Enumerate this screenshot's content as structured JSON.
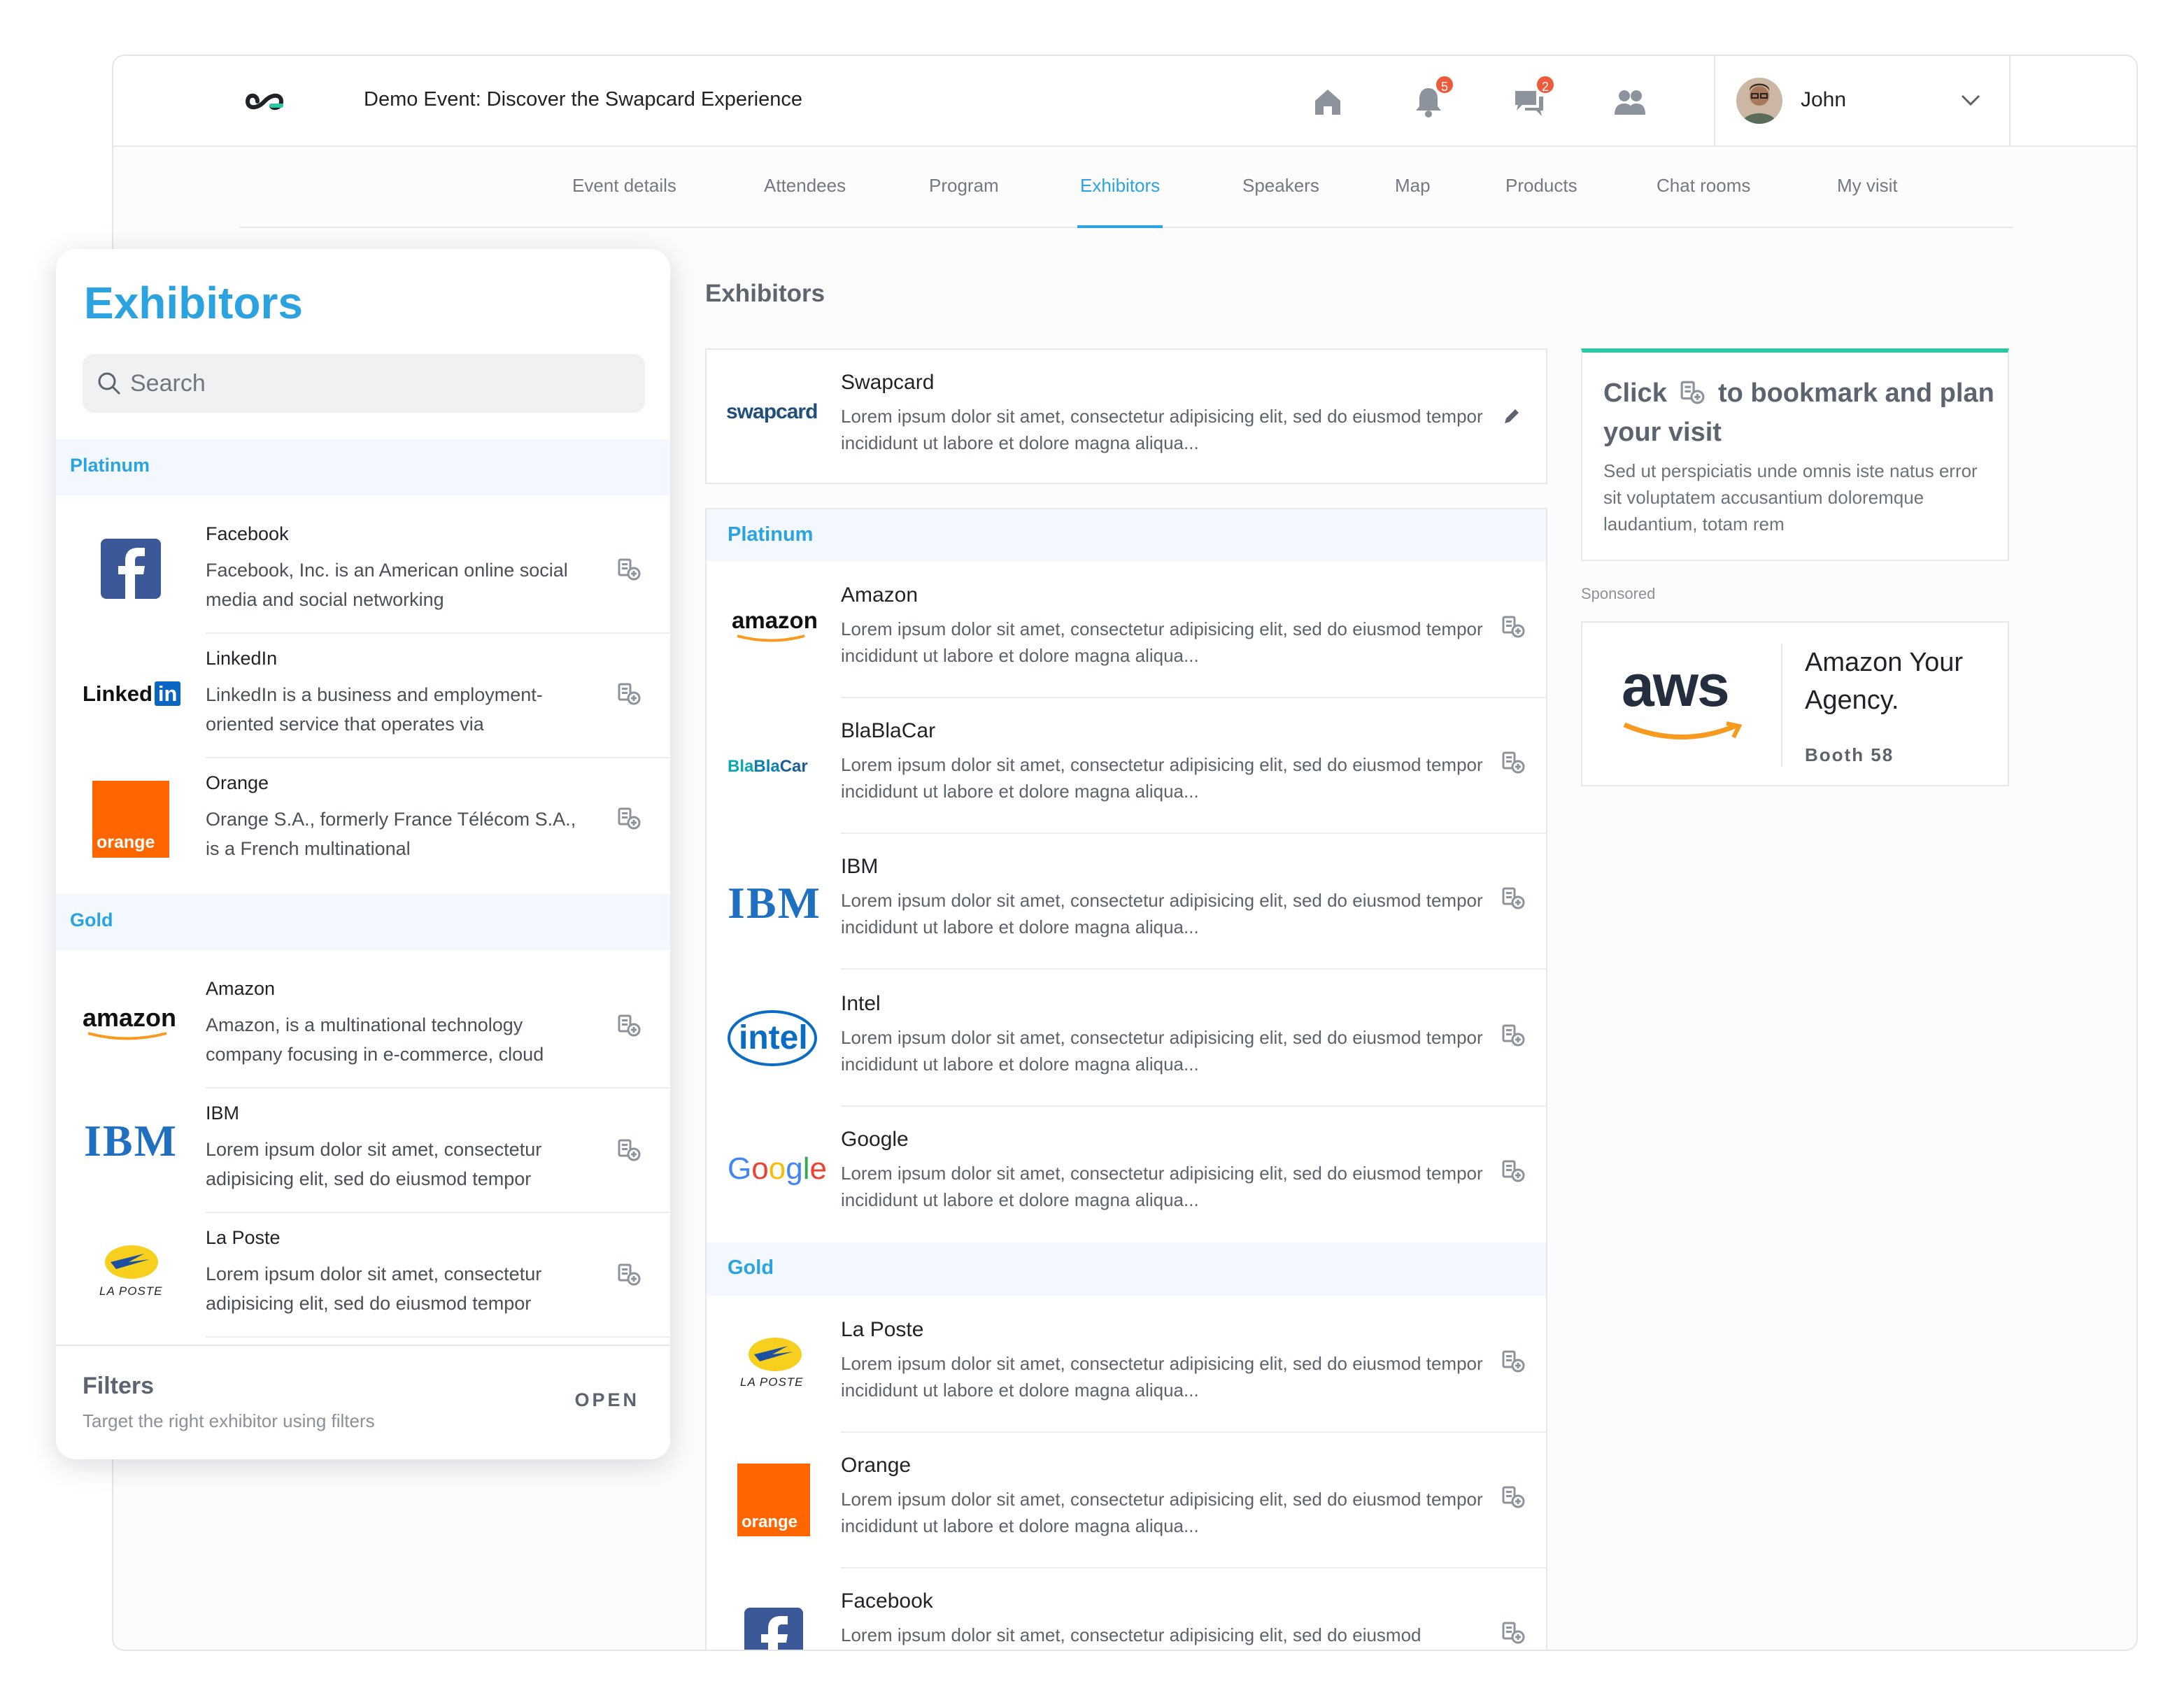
{
  "header": {
    "event_title": "Demo Event: Discover the Swapcard Experience",
    "notifications_count": "5",
    "messages_count": "2",
    "user_name": "John"
  },
  "nav": {
    "tabs": [
      "Event details",
      "Attendees",
      "Program",
      "Exhibitors",
      "Speakers",
      "Map",
      "Products",
      "Chat rooms",
      "My visit"
    ],
    "active": "Exhibitors"
  },
  "main": {
    "heading": "Exhibitors",
    "featured": {
      "name": "Swapcard",
      "desc": "Lorem ipsum dolor sit amet, consectetur adipisicing elit, sed do eiusmod tempor incididunt ut labore et dolore magna aliqua...",
      "logo_text": "swapcard"
    },
    "tier_platinum": "Platinum",
    "tier_gold": "Gold",
    "rows": [
      {
        "name": "Amazon",
        "desc": "Lorem ipsum dolor sit amet, consectetur adipisicing elit, sed do eiusmod tempor incididunt ut labore et dolore magna aliqua..."
      },
      {
        "name": "BlaBlaCar",
        "desc": "Lorem ipsum dolor sit amet, consectetur adipisicing elit, sed do eiusmod tempor incididunt ut labore et dolore magna aliqua..."
      },
      {
        "name": "IBM",
        "desc": "Lorem ipsum dolor sit amet, consectetur adipisicing elit, sed do eiusmod tempor incididunt ut labore et dolore magna aliqua..."
      },
      {
        "name": "Intel",
        "desc": "Lorem ipsum dolor sit amet, consectetur adipisicing elit, sed do eiusmod tempor incididunt ut labore et dolore magna aliqua..."
      },
      {
        "name": "Google",
        "desc": "Lorem ipsum dolor sit amet, consectetur adipisicing elit, sed do eiusmod tempor incididunt ut labore et dolore magna aliqua..."
      },
      {
        "name": "La Poste",
        "desc": "Lorem ipsum dolor sit amet, consectetur adipisicing elit, sed do eiusmod tempor incididunt ut labore et dolore magna aliqua..."
      },
      {
        "name": "Orange",
        "desc": "Lorem ipsum dolor sit amet, consectetur adipisicing elit, sed do eiusmod tempor incididunt ut labore et dolore magna aliqua..."
      },
      {
        "name": "Facebook",
        "desc": "Lorem ipsum dolor sit amet, consectetur adipisicing elit, sed do eiusmod"
      }
    ]
  },
  "logos": {
    "amazon": "amazon",
    "linkedin": "Linked",
    "linkedin_in": "in",
    "orange": "orange",
    "ibm": "IBM",
    "laposte": "LA POSTE",
    "blablacar_1": "Bla",
    "blablacar_2": "Bla",
    "blablacar_3": "Car",
    "intel": "intel",
    "google": [
      "G",
      "o",
      "o",
      "g",
      "l",
      "e"
    ],
    "aws": "aws"
  },
  "tip": {
    "title_before": "Click",
    "title_after": "to bookmark and plan your visit",
    "text": "Sed ut perspiciatis unde omnis iste natus error sit voluptatem accusantium doloremque laudantium, totam rem"
  },
  "sponsored": {
    "label": "Sponsored",
    "name": "Amazon Your Agency.",
    "booth": "Booth 58"
  },
  "panel": {
    "title": "Exhibitors",
    "search_placeholder": "Search",
    "tier_platinum": "Platinum",
    "tier_gold": "Gold",
    "items": [
      {
        "name": "Facebook",
        "desc": "Facebook, Inc. is an American online social media and social networking"
      },
      {
        "name": "LinkedIn",
        "desc": "LinkedIn is a business and employment-oriented service that operates via"
      },
      {
        "name": "Orange",
        "desc": "Orange S.A., formerly France Télécom S.A., is a French multinational"
      },
      {
        "name": "Amazon",
        "desc": "Amazon, is a multinational technology company focusing in e-commerce, cloud"
      },
      {
        "name": "IBM",
        "desc": "Lorem ipsum dolor sit amet, consectetur adipisicing elit, sed do eiusmod tempor"
      },
      {
        "name": "La Poste",
        "desc": "Lorem ipsum dolor sit amet, consectetur adipisicing elit, sed do eiusmod tempor"
      }
    ],
    "filters_title": "Filters",
    "filters_sub": "Target the right exhibitor using filters",
    "filters_open": "OPEN"
  },
  "colors": {
    "accent": "#2ba3e0",
    "tip_top": "#2cc7a3",
    "badge": "#ee5a3c",
    "tier_band": "#f2f8fd"
  }
}
